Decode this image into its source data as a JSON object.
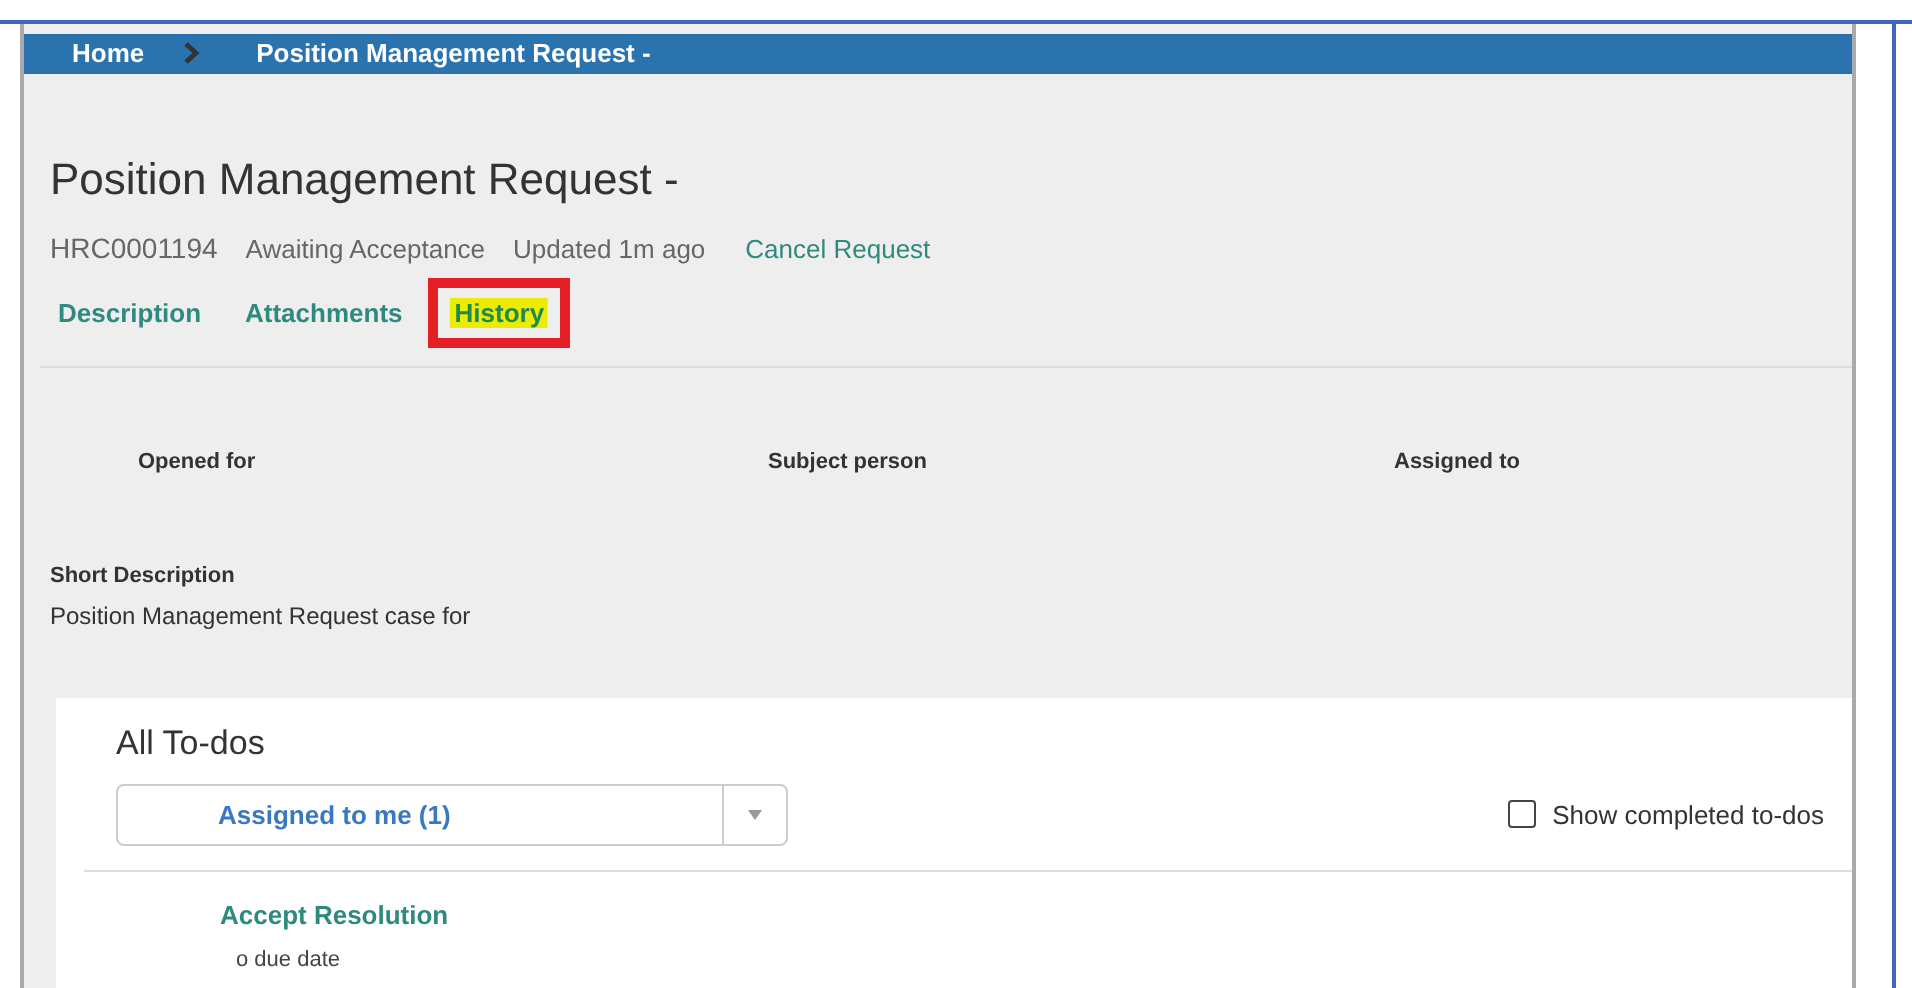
{
  "breadcrumb": [
    {
      "label": "Home"
    },
    {
      "label": "Position Management Request -"
    }
  ],
  "title": "Position Management Request -",
  "meta": {
    "number": "HRC0001194",
    "state": "Awaiting Acceptance",
    "updated": "Updated 1m ago",
    "action": "Cancel Request"
  },
  "tabs": [
    {
      "label": "Description",
      "selected": false
    },
    {
      "label": "Attachments",
      "selected": false
    },
    {
      "label": "History",
      "selected": true
    }
  ],
  "fields": [
    {
      "label": "Opened for"
    },
    {
      "label": "Subject person"
    },
    {
      "label": "Assigned to"
    }
  ],
  "short_description": {
    "label": "Short Description",
    "value": "Position Management Request case for"
  },
  "todos": {
    "title": "All To-dos",
    "filter": "Assigned to me (1)",
    "show_completed": {
      "label": "Show completed to-dos",
      "checked": false
    },
    "items": [
      {
        "title": "Accept Resolution",
        "due": "o due date"
      }
    ]
  }
}
